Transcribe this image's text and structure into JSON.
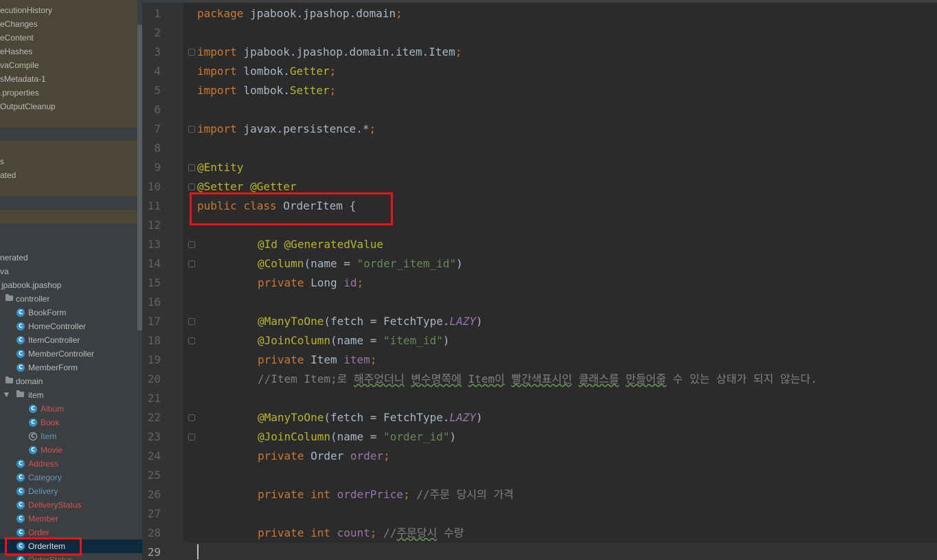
{
  "project_tree": {
    "items": [
      {
        "label": "ecutionHistory",
        "kind": "text"
      },
      {
        "label": "eChanges",
        "kind": "text"
      },
      {
        "label": "eContent",
        "kind": "text"
      },
      {
        "label": "eHashes",
        "kind": "text"
      },
      {
        "label": "vaCompile",
        "kind": "text"
      },
      {
        "label": "sMetadata-1",
        "kind": "text"
      },
      {
        "label": ".properties",
        "kind": "text"
      },
      {
        "label": "OutputCleanup",
        "kind": "text"
      },
      {
        "label": "s",
        "kind": "text"
      },
      {
        "label": "ated",
        "kind": "text"
      },
      {
        "label": "nerated",
        "kind": "text"
      },
      {
        "label": "va",
        "kind": "text"
      },
      {
        "label": "jpabook.jpashop",
        "kind": "text"
      },
      {
        "label": "controller",
        "kind": "folder"
      },
      {
        "label": "BookForm",
        "kind": "class"
      },
      {
        "label": "HomeController",
        "kind": "class"
      },
      {
        "label": "ItemController",
        "kind": "class"
      },
      {
        "label": "MemberController",
        "kind": "class"
      },
      {
        "label": "MemberForm",
        "kind": "class"
      },
      {
        "label": "domain",
        "kind": "folder"
      },
      {
        "label": "item",
        "kind": "folder-open"
      },
      {
        "label": "Album",
        "kind": "class-error"
      },
      {
        "label": "Book",
        "kind": "class-error"
      },
      {
        "label": "Item",
        "kind": "abstract-class"
      },
      {
        "label": "Movie",
        "kind": "class-error"
      },
      {
        "label": "Address",
        "kind": "class-error"
      },
      {
        "label": "Category",
        "kind": "class-modified"
      },
      {
        "label": "Delivery",
        "kind": "class-modified"
      },
      {
        "label": "DeliveryStatus",
        "kind": "class-error"
      },
      {
        "label": "Member",
        "kind": "class-error"
      },
      {
        "label": "Order",
        "kind": "class-error"
      },
      {
        "label": "OrderItem",
        "kind": "class-selected"
      },
      {
        "label": "OrderStatus",
        "kind": "class-error"
      }
    ],
    "icon_letters": {
      "class": "C",
      "abstract": "C"
    }
  },
  "editor": {
    "line_numbers": [
      "1",
      "2",
      "3",
      "4",
      "5",
      "6",
      "7",
      "8",
      "9",
      "10",
      "11",
      "12",
      "13",
      "14",
      "15",
      "16",
      "17",
      "18",
      "19",
      "20",
      "21",
      "22",
      "23",
      "24",
      "25",
      "26",
      "27",
      "28",
      "29"
    ],
    "current_line": "29",
    "tokens": {
      "package_kw": "package",
      "package_name": " jpabook.jpashop.domain",
      "import_kw": "import",
      "import_item": " jpabook.jpashop.domain.item.Item",
      "lombok": " lombok.",
      "getter": "Getter",
      "setter": "Setter",
      "javax": " javax.persistence.*",
      "semicolon": ";",
      "entity": "@Entity",
      "setter_ann": "@Setter",
      "getter_ann": "@Getter",
      "public": "public",
      "class": "class",
      "class_name": " OrderItem ",
      "brace_open": "{",
      "id_ann": "@Id",
      "gen_ann": "@GeneratedValue",
      "column_ann": "@Column",
      "name_eq": "(name = ",
      "order_item_id": "\"order_item_id\"",
      "paren_close": ")",
      "private": "private",
      "long_type": " Long ",
      "id_field": "id",
      "many_to_one": "@ManyToOne",
      "fetch_eq": "(fetch = FetchType.",
      "lazy": "LAZY",
      "join_column": "@JoinColumn",
      "item_id": "\"item_id\"",
      "item_type": " Item ",
      "item_field": "item",
      "comment_20a": "//Item Item;로 ",
      "ko_1": "해주었더니",
      "ko_2": "변수명쪽에",
      "ko_3": "Item이",
      "ko_4": "빨간색표시인",
      "ko_5": "클래스를",
      "ko_6": "만들어줄",
      "comment_20b": " 수 있는 상태가 되지 않는다.",
      "order_id": "\"order_id\"",
      "order_type": " Order ",
      "order_field": "order",
      "int_kw": " int ",
      "order_price": "orderPrice",
      "comment_26": " //주문 당시의 가격",
      "count_field": "count",
      "comment_28a": " //",
      "ko_7": "주문당시",
      "comment_28b": " 수량"
    }
  },
  "highlight_color": "#e8141b"
}
